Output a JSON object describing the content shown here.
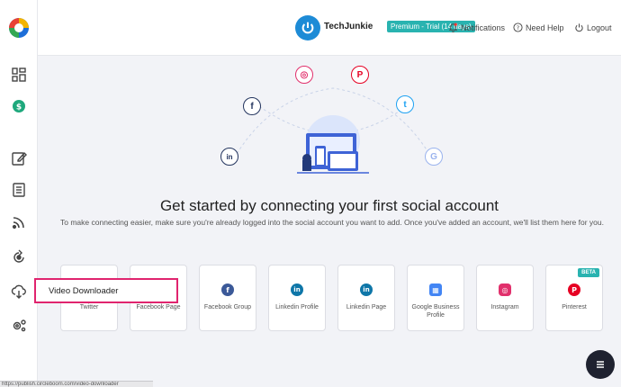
{
  "header": {
    "brand": "TechJunkie",
    "plan_badge": "Premium - Trial (14 days)",
    "notifications": "Notifications",
    "need_help": "Need Help",
    "logout": "Logout"
  },
  "sidebar": {
    "icons": [
      "dashboard-icon",
      "billing-icon",
      "compose-icon",
      "posts-icon",
      "rss-icon",
      "rotate-icon",
      "video-downloader-icon",
      "settings-icon"
    ]
  },
  "main": {
    "heading": "Get started by connecting your first social account",
    "subtext": "To make connecting easier, make sure you're already logged into the social account you want to add. Once you've added an account, we'll list them here for you."
  },
  "accounts": [
    {
      "label": "Twitter",
      "color": "#1da1f2"
    },
    {
      "label": "Facebook Page",
      "color": "#3b5998"
    },
    {
      "label": "Facebook Group",
      "color": "#3b5998"
    },
    {
      "label": "Linkedin Profile",
      "color": "#0e76a8"
    },
    {
      "label": "Linkedin Page",
      "color": "#0e76a8"
    },
    {
      "label": "Google Business Profile",
      "color": "#4285f4"
    },
    {
      "label": "Instagram",
      "color": "#e1306c"
    },
    {
      "label": "Pinterest",
      "color": "#e60023",
      "badge": "BETA"
    }
  ],
  "tooltip": {
    "label": "Video Downloader"
  },
  "status_url": "https://publish.circleboom.com/video-downloader"
}
